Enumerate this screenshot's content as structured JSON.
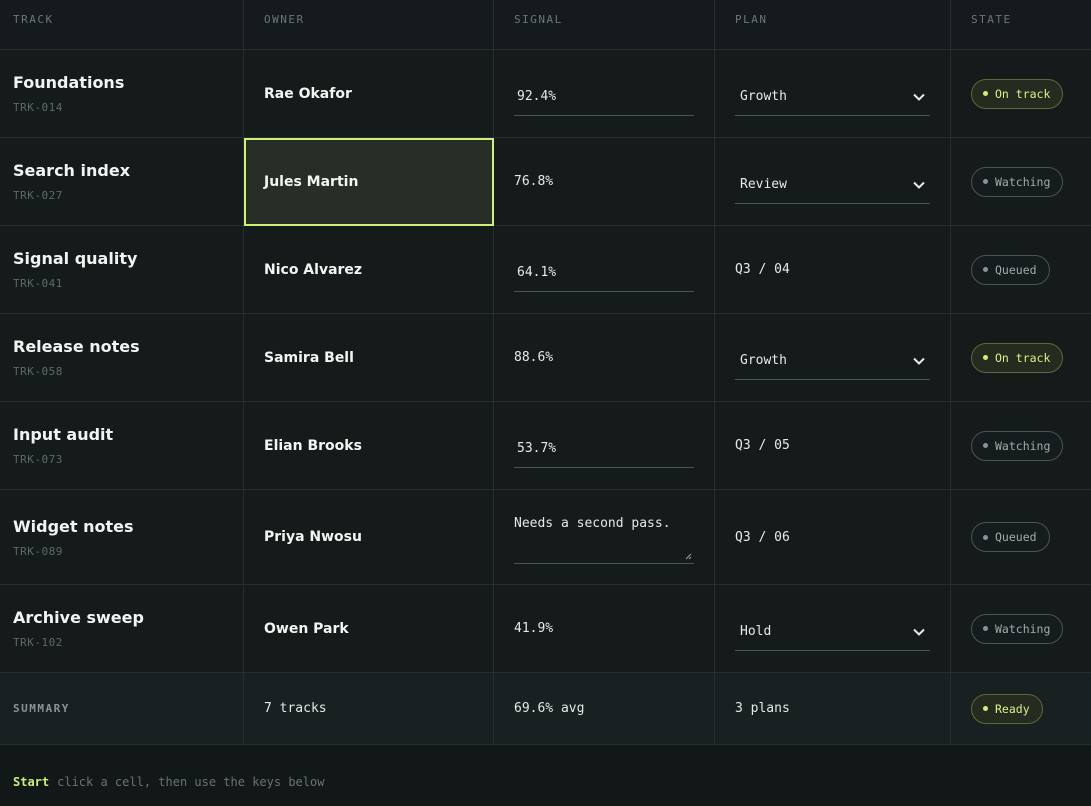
{
  "headers": {
    "track": "TRACK",
    "owner": "OWNER",
    "signal": "SIGNAL",
    "plan": "PLAN",
    "state": "STATE"
  },
  "rows": [
    {
      "name": "Foundations",
      "id": "TRK-014",
      "owner": "Rae Okafor",
      "signal": "92.4%",
      "plan": "Growth",
      "state": "On track"
    },
    {
      "name": "Search index",
      "id": "TRK-027",
      "owner": "Jules Martin",
      "signal": "76.8%",
      "plan": "Review",
      "state": "Watching"
    },
    {
      "name": "Signal quality",
      "id": "TRK-041",
      "owner": "Nico Alvarez",
      "signal": "64.1%",
      "plan": "Q3 / 04",
      "state": "Queued"
    },
    {
      "name": "Release notes",
      "id": "TRK-058",
      "owner": "Samira Bell",
      "signal": "88.6%",
      "plan": "Growth",
      "state": "On track"
    },
    {
      "name": "Input audit",
      "id": "TRK-073",
      "owner": "Elian Brooks",
      "signal": "53.7%",
      "plan": "Q3 / 05",
      "state": "Watching"
    },
    {
      "name": "Widget notes",
      "id": "TRK-089",
      "owner": "Priya Nwosu",
      "signal": "Needs a second pass.",
      "plan": "Q3 / 06",
      "state": "Queued"
    },
    {
      "name": "Archive sweep",
      "id": "TRK-102",
      "owner": "Owen Park",
      "signal": "41.9%",
      "plan": "Hold",
      "state": "Watching"
    }
  ],
  "summary": {
    "label": "SUMMARY",
    "tracks": "7 tracks",
    "signal": "69.6% avg",
    "plans": "3 plans",
    "state": "Ready"
  },
  "footer": {
    "key": "Start",
    "hint": "click a cell, then use the keys below"
  },
  "colors": {
    "accent": "#cdf07a",
    "background": "#121718",
    "border": "#262e2f"
  }
}
